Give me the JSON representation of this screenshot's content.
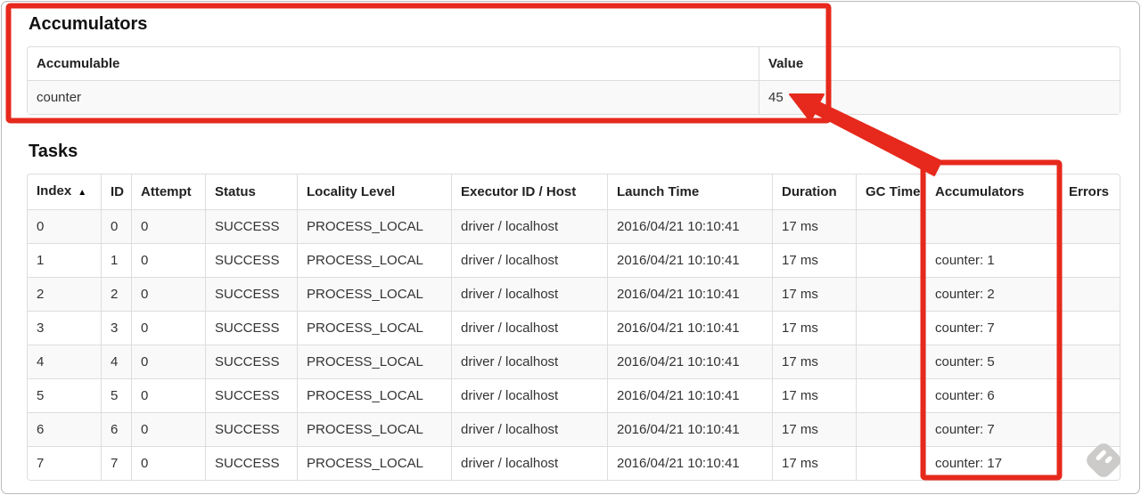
{
  "accumulators_section": {
    "title": "Accumulators",
    "headers": {
      "name": "Accumulable",
      "value": "Value"
    },
    "rows": [
      {
        "name": "counter",
        "value": "45"
      }
    ]
  },
  "tasks_section": {
    "title": "Tasks",
    "sort_indicator": "▲",
    "headers": [
      "Index",
      "ID",
      "Attempt",
      "Status",
      "Locality Level",
      "Executor ID / Host",
      "Launch Time",
      "Duration",
      "GC Time",
      "Accumulators",
      "Errors"
    ],
    "rows": [
      [
        "0",
        "0",
        "0",
        "SUCCESS",
        "PROCESS_LOCAL",
        "driver / localhost",
        "2016/04/21 10:10:41",
        "17 ms",
        "",
        "",
        ""
      ],
      [
        "1",
        "1",
        "0",
        "SUCCESS",
        "PROCESS_LOCAL",
        "driver / localhost",
        "2016/04/21 10:10:41",
        "17 ms",
        "",
        "counter: 1",
        ""
      ],
      [
        "2",
        "2",
        "0",
        "SUCCESS",
        "PROCESS_LOCAL",
        "driver / localhost",
        "2016/04/21 10:10:41",
        "17 ms",
        "",
        "counter: 2",
        ""
      ],
      [
        "3",
        "3",
        "0",
        "SUCCESS",
        "PROCESS_LOCAL",
        "driver / localhost",
        "2016/04/21 10:10:41",
        "17 ms",
        "",
        "counter: 7",
        ""
      ],
      [
        "4",
        "4",
        "0",
        "SUCCESS",
        "PROCESS_LOCAL",
        "driver / localhost",
        "2016/04/21 10:10:41",
        "17 ms",
        "",
        "counter: 5",
        ""
      ],
      [
        "5",
        "5",
        "0",
        "SUCCESS",
        "PROCESS_LOCAL",
        "driver / localhost",
        "2016/04/21 10:10:41",
        "17 ms",
        "",
        "counter: 6",
        ""
      ],
      [
        "6",
        "6",
        "0",
        "SUCCESS",
        "PROCESS_LOCAL",
        "driver / localhost",
        "2016/04/21 10:10:41",
        "17 ms",
        "",
        "counter: 7",
        ""
      ],
      [
        "7",
        "7",
        "0",
        "SUCCESS",
        "PROCESS_LOCAL",
        "driver / localhost",
        "2016/04/21 10:10:41",
        "17 ms",
        "",
        "counter: 17",
        ""
      ]
    ]
  },
  "annotations": {
    "color": "#e6291c",
    "highlight_1": "accumulators-summary-box",
    "highlight_2": "accumulators-column-box",
    "arrow_meaning": "tasks accumulators sum points to total value 45"
  },
  "watermark": {
    "icon": "feedly-logo"
  }
}
